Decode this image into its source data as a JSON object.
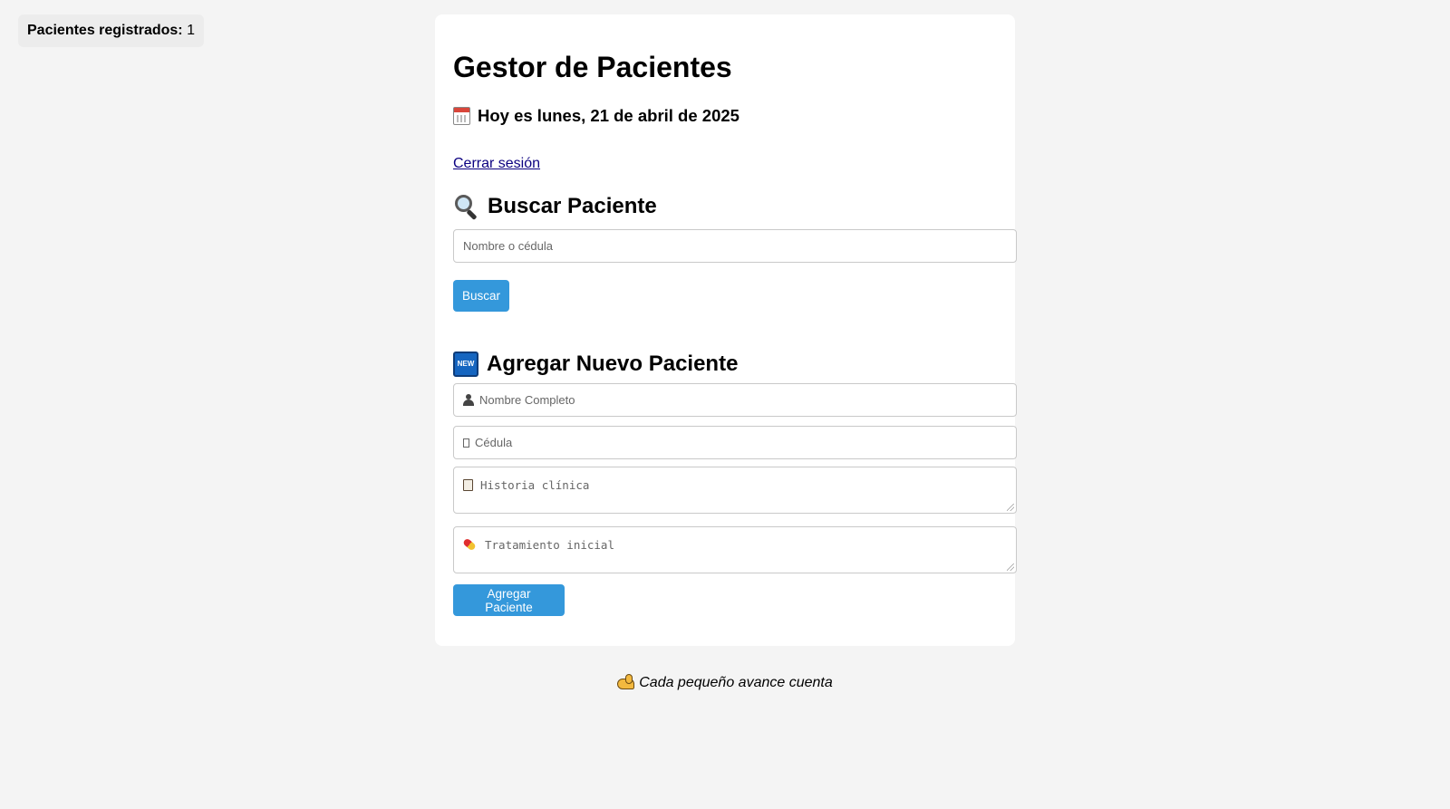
{
  "counter": {
    "label": "Pacientes registrados:",
    "value": "1"
  },
  "header": {
    "title": "Gestor de Pacientes",
    "date": "Hoy es lunes, 21 de abril de 2025",
    "date_icon": "calendar-icon",
    "logout": "Cerrar sesión"
  },
  "search": {
    "heading": "Buscar Paciente",
    "icon": "magnifier-icon",
    "placeholder": "Nombre o cédula",
    "button": "Buscar"
  },
  "add": {
    "heading": "Agregar Nuevo Paciente",
    "icon": "new-icon",
    "name_placeholder": "Nombre Completo",
    "cedula_placeholder": "Cédula",
    "history_placeholder": "Historia clínica",
    "treatment_placeholder": "Tratamiento inicial",
    "button": "Agregar Paciente"
  },
  "footer": {
    "motto": "Cada pequeño avance cuenta",
    "icon": "flexed-arm-icon"
  },
  "colors": {
    "accent": "#3498db",
    "background": "#f4f4f4",
    "card": "#ffffff"
  }
}
